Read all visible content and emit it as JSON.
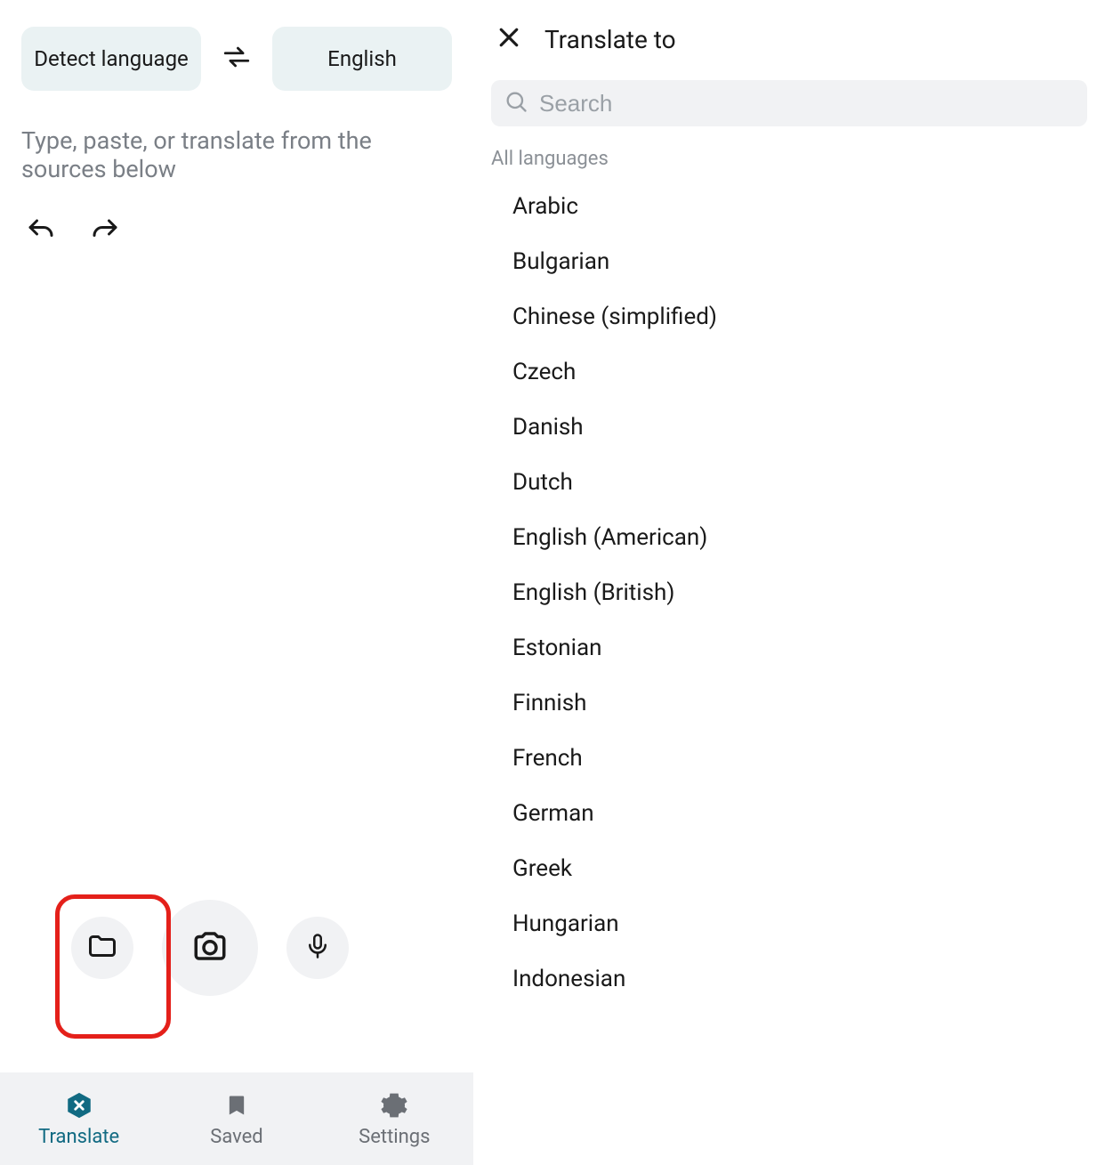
{
  "left": {
    "source_lang": "Detect language",
    "target_lang": "English",
    "input_placeholder": "Type, paste, or translate from the sources below"
  },
  "panel": {
    "title": "Translate to",
    "search_placeholder": "Search",
    "section_label": "All languages",
    "languages": [
      "Arabic",
      "Bulgarian",
      "Chinese (simplified)",
      "Czech",
      "Danish",
      "Dutch",
      "English (American)",
      "English (British)",
      "Estonian",
      "Finnish",
      "French",
      "German",
      "Greek",
      "Hungarian",
      "Indonesian"
    ]
  },
  "nav": {
    "translate": "Translate",
    "saved": "Saved",
    "settings": "Settings"
  }
}
